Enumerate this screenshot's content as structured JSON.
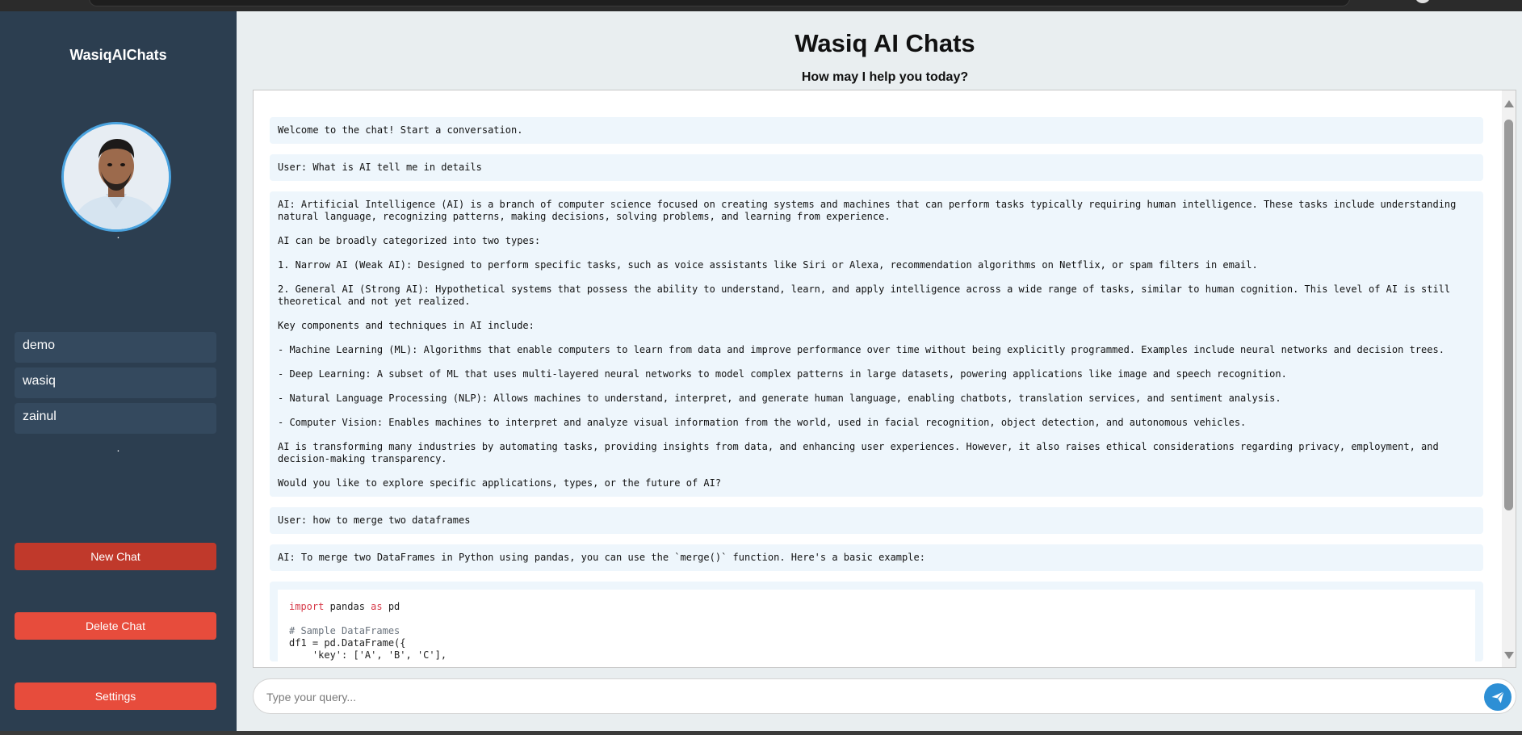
{
  "sidebar": {
    "brand": "WasiqAIChats",
    "dot_top": ".",
    "dot_bottom": ".",
    "chats": [
      "demo",
      "wasiq",
      "zainul"
    ],
    "new_chat_label": "New Chat",
    "delete_chat_label": "Delete Chat",
    "settings_label": "Settings"
  },
  "header": {
    "title": "Wasiq AI Chats",
    "subtitle": "How may I help you today?"
  },
  "messages": [
    "Welcome to the chat! Start a conversation.",
    "User: What is AI tell me in details",
    "AI: Artificial Intelligence (AI) is a branch of computer science focused on creating systems and machines that can perform tasks typically requiring human intelligence. These tasks include understanding natural language, recognizing patterns, making decisions, solving problems, and learning from experience.\n\nAI can be broadly categorized into two types:\n\n1. Narrow AI (Weak AI): Designed to perform specific tasks, such as voice assistants like Siri or Alexa, recommendation algorithms on Netflix, or spam filters in email.\n\n2. General AI (Strong AI): Hypothetical systems that possess the ability to understand, learn, and apply intelligence across a wide range of tasks, similar to human cognition. This level of AI is still theoretical and not yet realized.\n\nKey components and techniques in AI include:\n\n- Machine Learning (ML): Algorithms that enable computers to learn from data and improve performance over time without being explicitly programmed. Examples include neural networks and decision trees.\n\n- Deep Learning: A subset of ML that uses multi-layered neural networks to model complex patterns in large datasets, powering applications like image and speech recognition.\n\n- Natural Language Processing (NLP): Allows machines to understand, interpret, and generate human language, enabling chatbots, translation services, and sentiment analysis.\n\n- Computer Vision: Enables machines to interpret and analyze visual information from the world, used in facial recognition, object detection, and autonomous vehicles.\n\nAI is transforming many industries by automating tasks, providing insights from data, and enhancing user experiences. However, it also raises ethical considerations regarding privacy, employment, and decision-making transparency.\n\nWould you like to explore specific applications, types, or the future of AI?",
    "User: how to merge two dataframes",
    "AI: To merge two DataFrames in Python using pandas, you can use the `merge()` function. Here's a basic example:"
  ],
  "code": {
    "line1_kw1": "import",
    "line1_mid": " pandas ",
    "line1_kw2": "as",
    "line1_end": " pd",
    "line3": "# Sample DataFrames",
    "line4": "df1 = pd.DataFrame({",
    "line5": "    'key': ['A', 'B', 'C'],"
  },
  "input": {
    "placeholder": "Type your query...",
    "value": ""
  },
  "icons": {
    "send": "paper-plane-icon",
    "profile": "profile-photo",
    "scroll_up": "scroll-up-arrow",
    "scroll_down": "scroll-down-arrow"
  },
  "colors": {
    "sidebar_bg": "#2c3e50",
    "chat_item_bg": "#34495e",
    "new_chat": "#c0392b",
    "delete_chat": "#e74c3c",
    "settings": "#e74c3c",
    "message_bg": "#eef6fc",
    "send_button": "#2d8fd5"
  }
}
